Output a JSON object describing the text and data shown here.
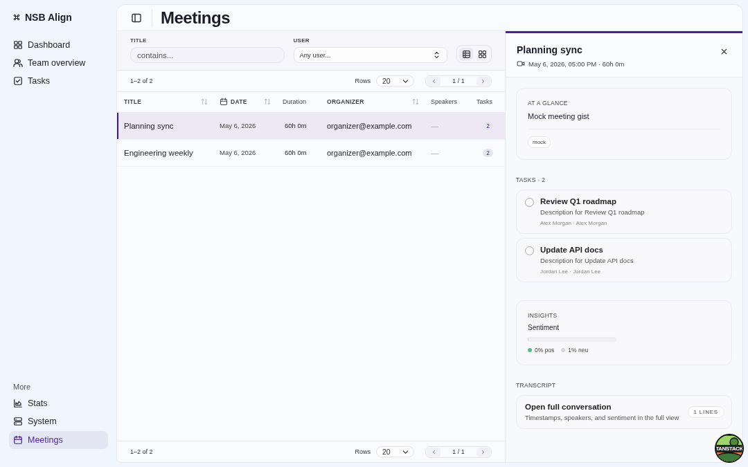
{
  "app": {
    "name": "NSB Align"
  },
  "sidebar": {
    "items": [
      {
        "label": "Dashboard",
        "kind": "dashboard",
        "selected": false
      },
      {
        "label": "Team overview",
        "kind": "team",
        "selected": false
      },
      {
        "label": "Tasks",
        "kind": "tasks",
        "selected": false
      }
    ],
    "section_label": "More",
    "more_items": [
      {
        "label": "Stats",
        "kind": "stats",
        "selected": false
      },
      {
        "label": "System",
        "kind": "system",
        "selected": false
      },
      {
        "label": "Meetings",
        "kind": "meetings",
        "selected": true
      }
    ]
  },
  "header": {
    "title": "Meetings"
  },
  "filters": {
    "title_label": "TITLE",
    "title_placeholder": "contains...",
    "user_label": "USER",
    "user_value": "Any user...",
    "view_modes": [
      {
        "kind": "table",
        "selected": true
      },
      {
        "kind": "grid",
        "selected": false
      }
    ]
  },
  "pagination_top": {
    "range": "1–2 of 2",
    "rows_label": "Rows",
    "rows_value": "20",
    "page": "1 / 1"
  },
  "table": {
    "columns": [
      {
        "label": "TITLE",
        "kind": "title",
        "sortable": true
      },
      {
        "label": "DATE",
        "kind": "date",
        "sortable": true
      },
      {
        "label": "Duration",
        "kind": "duration",
        "sortable": false
      },
      {
        "label": "ORGANIZER",
        "kind": "organizer",
        "sortable": true
      },
      {
        "label": "Speakers",
        "kind": "speakers",
        "sortable": false
      },
      {
        "label": "Tasks",
        "kind": "tasks",
        "sortable": false
      }
    ],
    "rows": [
      {
        "cells": [
          "Planning sync",
          "May 6, 2026",
          "60h 0m",
          "organizer@example.com",
          "—",
          "2"
        ],
        "selected": true
      },
      {
        "cells": [
          "Engineering weekly",
          "May 6, 2026",
          "60h 0m",
          "organizer@example.com",
          "—",
          "2"
        ],
        "selected": false
      }
    ]
  },
  "pagination_bottom": {
    "range": "1–2 of 2",
    "rows_label": "Rows",
    "rows_value": "20",
    "page": "1 / 1"
  },
  "detail": {
    "title": "Planning sync",
    "meta": "May 6, 2026, 05:00 PM · 60h 0m",
    "glance": {
      "label": "AT A GLANCE",
      "gist": "Mock meeting gist",
      "tags": [
        "mock"
      ]
    },
    "tasks_heading": "TASKS · 2",
    "tasks": [
      {
        "title": "Review Q1 roadmap",
        "description": "Description for Review Q1 roadmap",
        "people": "Alex Morgan · Alex Morgan",
        "checked": false
      },
      {
        "title": "Update API docs",
        "description": "Description for Update API docs",
        "people": "Jordan Lee · Jordan Lee",
        "checked": false
      }
    ],
    "insights": {
      "label": "INSIGHTS",
      "metric": "Sentiment",
      "level": 0.01,
      "segments": [
        {
          "label": "0% pos",
          "color": "#4cbf8a"
        },
        {
          "label": "1% neu",
          "color": "#d5d5de"
        }
      ]
    },
    "transcript": {
      "heading": "TRANSCRIPT",
      "title": "Open full conversation",
      "subtitle": "Timestamps, speakers, and sentiment in the full view",
      "badge": "1 LINES"
    }
  },
  "devtools": {
    "label": "TANSTACK"
  }
}
